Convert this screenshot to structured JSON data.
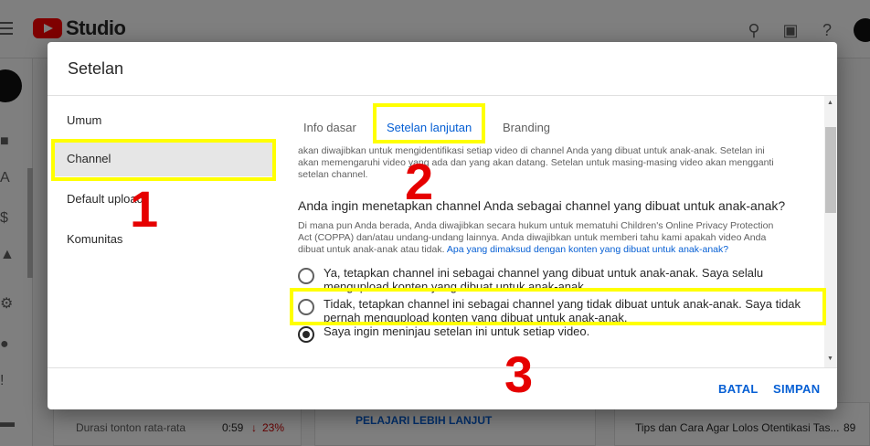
{
  "app": {
    "brand": "Studio"
  },
  "background": {
    "card1_label": "Durasi tonton rata-rata",
    "card1_value": "0:59",
    "card1_change": "23%",
    "card2_link": "PELAJARI LEBIH LANJUT",
    "card3_label": "Tips dan Cara Agar Lolos Otentikasi Tas...",
    "card3_value": "89"
  },
  "dialog": {
    "title": "Setelan",
    "nav": [
      "Umum",
      "Channel",
      "Default upload",
      "Komunitas"
    ],
    "tabs": [
      "Info dasar",
      "Setelan lanjutan",
      "Branding"
    ],
    "intro_line1": "akan diwajibkan untuk mengidentifikasi setiap video di channel Anda yang dibuat untuk anak-anak. Setelan ini",
    "intro_line2": "akan memengaruhi video yang ada dan yang akan datang. Setelan untuk masing-masing video akan mengganti",
    "intro_line3": "setelan channel.",
    "question": "Anda ingin menetapkan channel Anda sebagai channel yang dibuat untuk anak-anak?",
    "desc_line1": "Di mana pun Anda berada, Anda diwajibkan secara hukum untuk mematuhi Children's Online Privacy Protection",
    "desc_line2": "Act (COPPA) dan/atau undang-undang lainnya. Anda diwajibkan untuk memberi tahu kami apakah video Anda",
    "desc_line3": "dibuat untuk anak-anak atau tidak.",
    "desc_link": "Apa yang dimaksud dengan konten yang dibuat untuk anak-anak?",
    "options": [
      {
        "line1": "Ya, tetapkan channel ini sebagai channel yang dibuat untuk anak-anak. Saya selalu",
        "line2": "mengupload konten yang dibuat untuk anak-anak."
      },
      {
        "line1": "Tidak, tetapkan channel ini sebagai channel yang tidak dibuat untuk anak-anak. Saya tidak",
        "line2": "pernah mengupload konten yang dibuat untuk anak-anak."
      },
      {
        "line1": "Saya ingin meninjau setelan ini untuk setiap video.",
        "line2": ""
      }
    ],
    "selected_option": 3,
    "cancel_label": "BATAL",
    "save_label": "SIMPAN"
  },
  "annotations": {
    "n1": "1",
    "n2": "2",
    "n3": "3",
    "color": "#e60000",
    "highlight": "#ffff00"
  }
}
